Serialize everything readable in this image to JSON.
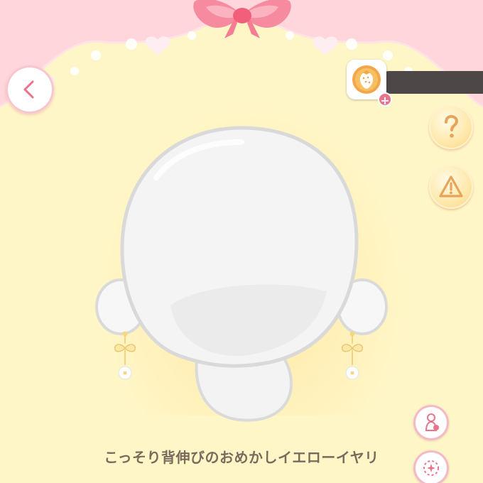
{
  "header": {
    "back_icon": "chevron-left-icon",
    "ribbon_icon": "pink-ribbon-icon"
  },
  "currency": {
    "icon": "strawberry-coin-icon",
    "value": "",
    "add_icon": "plus-icon"
  },
  "side_buttons": {
    "help_icon": "question-mark-icon",
    "report_icon": "warning-triangle-icon"
  },
  "tools": {
    "tool1_icon": "mannequin-icon",
    "tool2_icon": "sparkle-icon"
  },
  "item": {
    "name": "こっそり背伸びのおめかしイエローイヤリ"
  },
  "colors": {
    "background": "#fff6c8",
    "header_pink": "#ffd6dc",
    "accent_pink": "#f7a7b6",
    "text_brown": "#7b6a5c"
  }
}
